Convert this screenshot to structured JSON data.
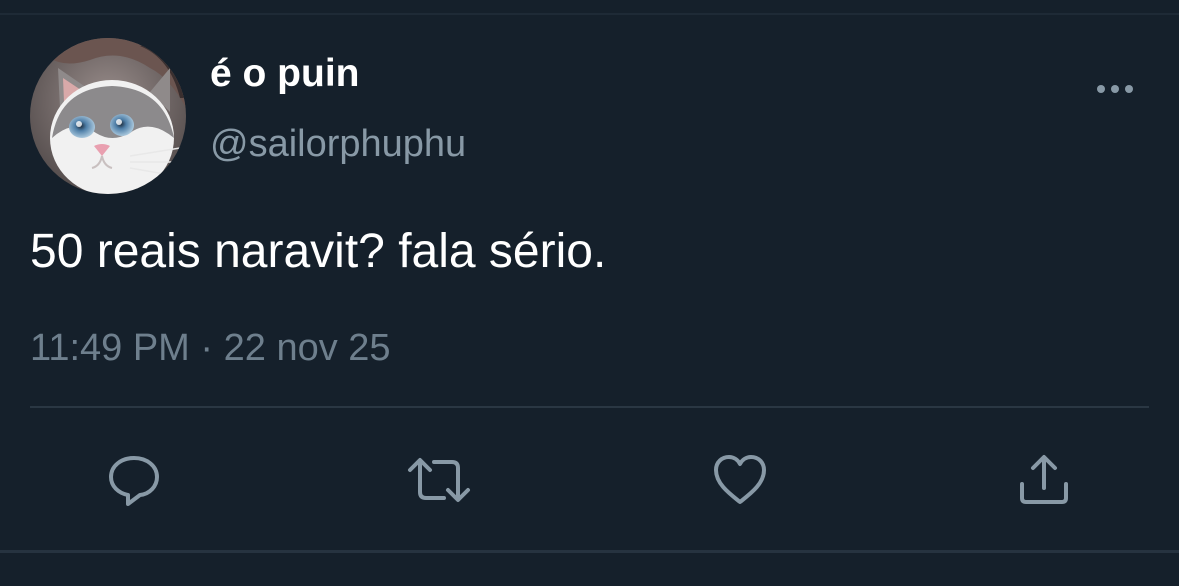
{
  "tweet": {
    "display_name": "é o puin",
    "handle": "@sailorphuphu",
    "text": "50 reais naravit? fala sério.",
    "time": "11:49 PM",
    "separator": "·",
    "date": "22 nov 25"
  },
  "icons": {
    "more": "more-horizontal-icon",
    "reply": "reply-bubble-icon",
    "retweet": "retweet-icon",
    "like": "heart-icon",
    "share": "share-upload-icon"
  },
  "colors": {
    "background": "#15202b",
    "primary_text": "#ffffff",
    "secondary_text": "#8899a6",
    "icon": "#8899a6",
    "divider": "#2a3743"
  }
}
